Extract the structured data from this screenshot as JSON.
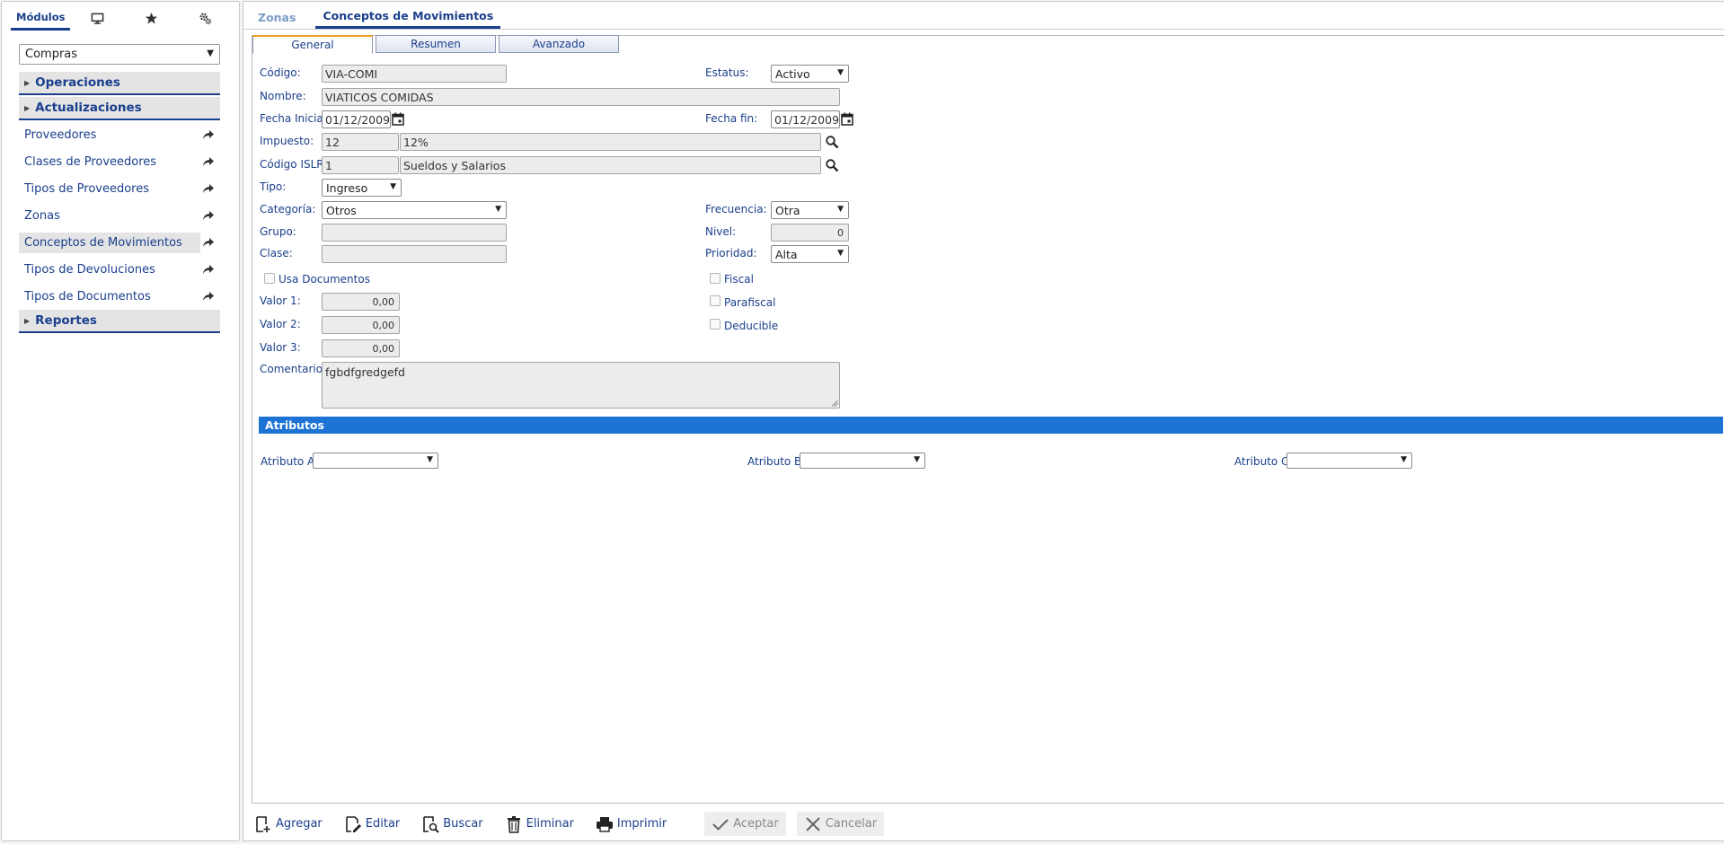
{
  "sidebar": {
    "tab_label": "Módulos",
    "tab_icons": [
      "monitor-icon",
      "star-icon",
      "gear-cogs-icon"
    ],
    "module": "Compras",
    "sections": {
      "operaciones": "Operaciones",
      "actualizaciones": "Actualizaciones",
      "reportes": "Reportes"
    },
    "items": [
      "Proveedores",
      "Clases de Proveedores",
      "Tipos de Proveedores",
      "Zonas",
      "Conceptos de Movimientos",
      "Tipos de Devoluciones",
      "Tipos de Documentos"
    ],
    "active_item": "Conceptos de Movimientos"
  },
  "top_tabs": [
    "Zonas",
    "Conceptos de Movimientos"
  ],
  "sub_tabs": [
    "General",
    "Resumen",
    "Avanzado"
  ],
  "form": {
    "labels": {
      "codigo": "Código:",
      "nombre": "Nombre:",
      "fecha_inicial": "Fecha Inicial:",
      "impuesto": "Impuesto:",
      "codigo_islr": "Código ISLR:",
      "tipo": "Tipo:",
      "categoria": "Categoría:",
      "grupo": "Grupo:",
      "clase": "Clase:",
      "valor1": "Valor 1:",
      "valor2": "Valor 2:",
      "valor3": "Valor 3:",
      "comentario": "Comentario:",
      "estatus": "Estatus:",
      "fecha_fin": "Fecha fin:",
      "frecuencia": "Frecuencia:",
      "nivel": "Nivel:",
      "prioridad": "Prioridad:"
    },
    "values": {
      "codigo": "VIA-COMI",
      "nombre": "VIATICOS COMIDAS",
      "fecha_inicial": "01/12/2009",
      "impuesto_code": "12",
      "impuesto_desc": "12%",
      "islr_code": "1",
      "islr_desc": "Sueldos y Salarios",
      "tipo": "Ingreso",
      "categoria": "Otros",
      "grupo": "",
      "clase": "",
      "valor1": "0,00",
      "valor2": "0,00",
      "valor3": "0,00",
      "comentario": "fgbdfgredgefd",
      "estatus": "Activo",
      "fecha_fin": "01/12/2009",
      "frecuencia": "Otra",
      "nivel": "0",
      "prioridad": "Alta"
    },
    "checkboxes": {
      "usa_documentos": "Usa Documentos",
      "fiscal": "Fiscal",
      "parafiscal": "Parafiscal",
      "deducible": "Deducible"
    }
  },
  "atributos": {
    "title": "Atributos",
    "labels": [
      "Atributo A:",
      "Atributo B:",
      "Atributo C:"
    ]
  },
  "toolbar": {
    "agregar": "Agregar",
    "editar": "Editar",
    "buscar": "Buscar",
    "eliminar": "Eliminar",
    "imprimir": "Imprimir",
    "aceptar": "Aceptar",
    "cancelar": "Cancelar"
  },
  "colors": {
    "accent": "#1a3f8c",
    "attr_bar": "#1c73d3",
    "active_tab_top": "#f0a020"
  }
}
